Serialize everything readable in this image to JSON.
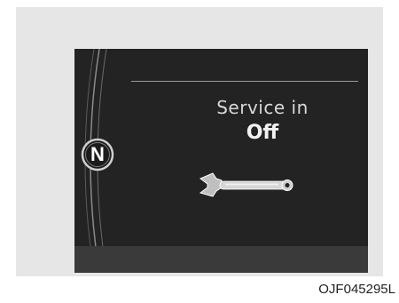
{
  "cluster": {
    "gear": "N",
    "service_title": "Service in",
    "service_value": "Off",
    "service_icon": "wrench-icon"
  },
  "figure": {
    "code": "OJF045295L"
  },
  "colors": {
    "screen": "#232323",
    "band": "#3a3a3a",
    "frame": "#e6e6e6",
    "text": "#f2f2f2"
  }
}
